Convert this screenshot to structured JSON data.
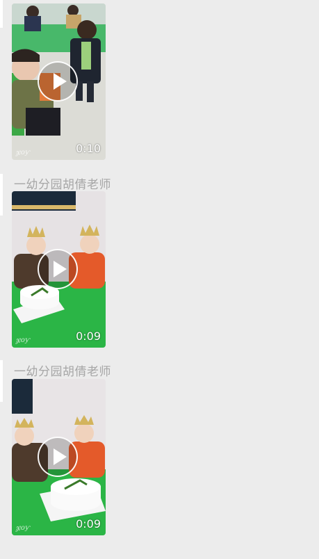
{
  "messages": [
    {
      "sender": "",
      "duration": "0:10",
      "watermark": "ჯoƴ"
    },
    {
      "sender": "一幼分园胡倩老师",
      "duration": "0:09",
      "watermark": "ჯoƴ"
    },
    {
      "sender": "一幼分园胡倩老师",
      "duration": "0:09",
      "watermark": "ჯoƴ"
    }
  ],
  "icons": {
    "play": "play-icon"
  },
  "colors": {
    "background": "#ececec",
    "sender_text": "#a6a6a6"
  }
}
